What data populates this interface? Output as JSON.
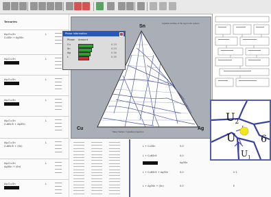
{
  "toolbar": {
    "buttons": [
      {
        "name": "tb-new-icon",
        "color": "#7a7a7a"
      },
      {
        "name": "tb-open-icon",
        "color": "#7a7a7a"
      },
      {
        "name": "tb-save-icon",
        "color": "#7a7a7a"
      },
      {
        "name": "tb-print-icon",
        "color": "#7a7a7a"
      },
      {
        "name": "tb-cut-icon",
        "color": "#7a7a7a"
      },
      {
        "name": "tb-copy-icon",
        "color": "#7a7a7a"
      },
      {
        "name": "tb-paste-icon",
        "color": "#7a7a7a"
      },
      {
        "name": "tb-undo-icon",
        "color": "#7a7a7a"
      },
      {
        "name": "tb-help-icon",
        "color": "#cc2222"
      },
      {
        "name": "tb-info-icon",
        "color": "#cc2222"
      },
      {
        "name": "tb-chart-icon",
        "color": "#2c8a3a"
      },
      {
        "name": "tb-tool-icon",
        "color": "#7a7a7a"
      },
      {
        "name": "tb-grid-icon",
        "color": "#7a7a7a"
      },
      {
        "name": "tb-table-icon",
        "color": "#7a7a7a"
      },
      {
        "name": "tb-zoom-icon",
        "color": "#7a7a7a"
      },
      {
        "name": "tb-fit-icon",
        "color": "#a0a0a0"
      },
      {
        "name": "tb-prev-icon",
        "color": "#a0a0a0"
      },
      {
        "name": "tb-next-icon",
        "color": "#a0a0a0"
      }
    ]
  },
  "left_pane": {
    "header": "Ternaries",
    "entries": [
      {
        "title": "Ag-Cu-Sn",
        "sub": "Cu3Sn + Ag3Sn",
        "phase": "L"
      },
      {
        "title": "Ag-Cu-Sn",
        "sub": "",
        "phase": "L"
      },
      {
        "title": "Ag-Cu-Sn",
        "sub": "",
        "phase": "L"
      },
      {
        "title": "Ag-Cu-Sn",
        "sub": "",
        "phase": "L"
      },
      {
        "title": "Ag-Cu-Sn",
        "sub": "Cu6Sn5 + Ag3Sn",
        "phase": "L"
      },
      {
        "title": "Ag-Cu-Sn",
        "sub": "Cu6Sn5 + (Sn)",
        "phase": "L"
      },
      {
        "title": "Ag-Cu-Sn",
        "sub": "Ag3Sn + (Sn)",
        "phase": "L"
      },
      {
        "title": "Ag-Cu-Sn",
        "sub": "",
        "phase": "L"
      }
    ]
  },
  "dialog": {
    "title": "Phase Information",
    "col_a": "Phase",
    "col_b": "Amount",
    "rows": [
      {
        "label": "Cu",
        "color": "#2f9d2f",
        "value": "0.10"
      },
      {
        "label": "Sn",
        "color": "#2f9d2f",
        "value": "0.25"
      },
      {
        "label": "Ag",
        "color": "#2f9d2f",
        "value": "0.30"
      },
      {
        "label": "L",
        "color": "#c83030",
        "value": "0.35"
      }
    ]
  },
  "ternary": {
    "top": "Sn",
    "left": "Cu",
    "right": "Ag",
    "note": "Liquidus surface of the Ag-Cu-Sn system",
    "caption": "Mass fraction / Liquidus projection"
  },
  "magnifier": {
    "u2": "U",
    "u2_sub": "2",
    "u": "U",
    "u_sub": "1",
    "six": "6",
    "point_color": "#f3e51f"
  },
  "bottom_table": {
    "rows": [
      {
        "a": "L + Cu3Sn",
        "b": "0.0",
        "c": ""
      },
      {
        "a": "L + Cu6Sn5",
        "b": "0.0",
        "c": ""
      },
      {
        "a": "",
        "b": "Ag3Sn",
        "c": ""
      },
      {
        "a": "L + Cu6Sn5 + Ag3Sn",
        "b": "0.0",
        "c": "U 1"
      },
      {
        "a": "L + Ag3Sn + (Sn)",
        "b": "0.0",
        "c": "E"
      }
    ]
  }
}
